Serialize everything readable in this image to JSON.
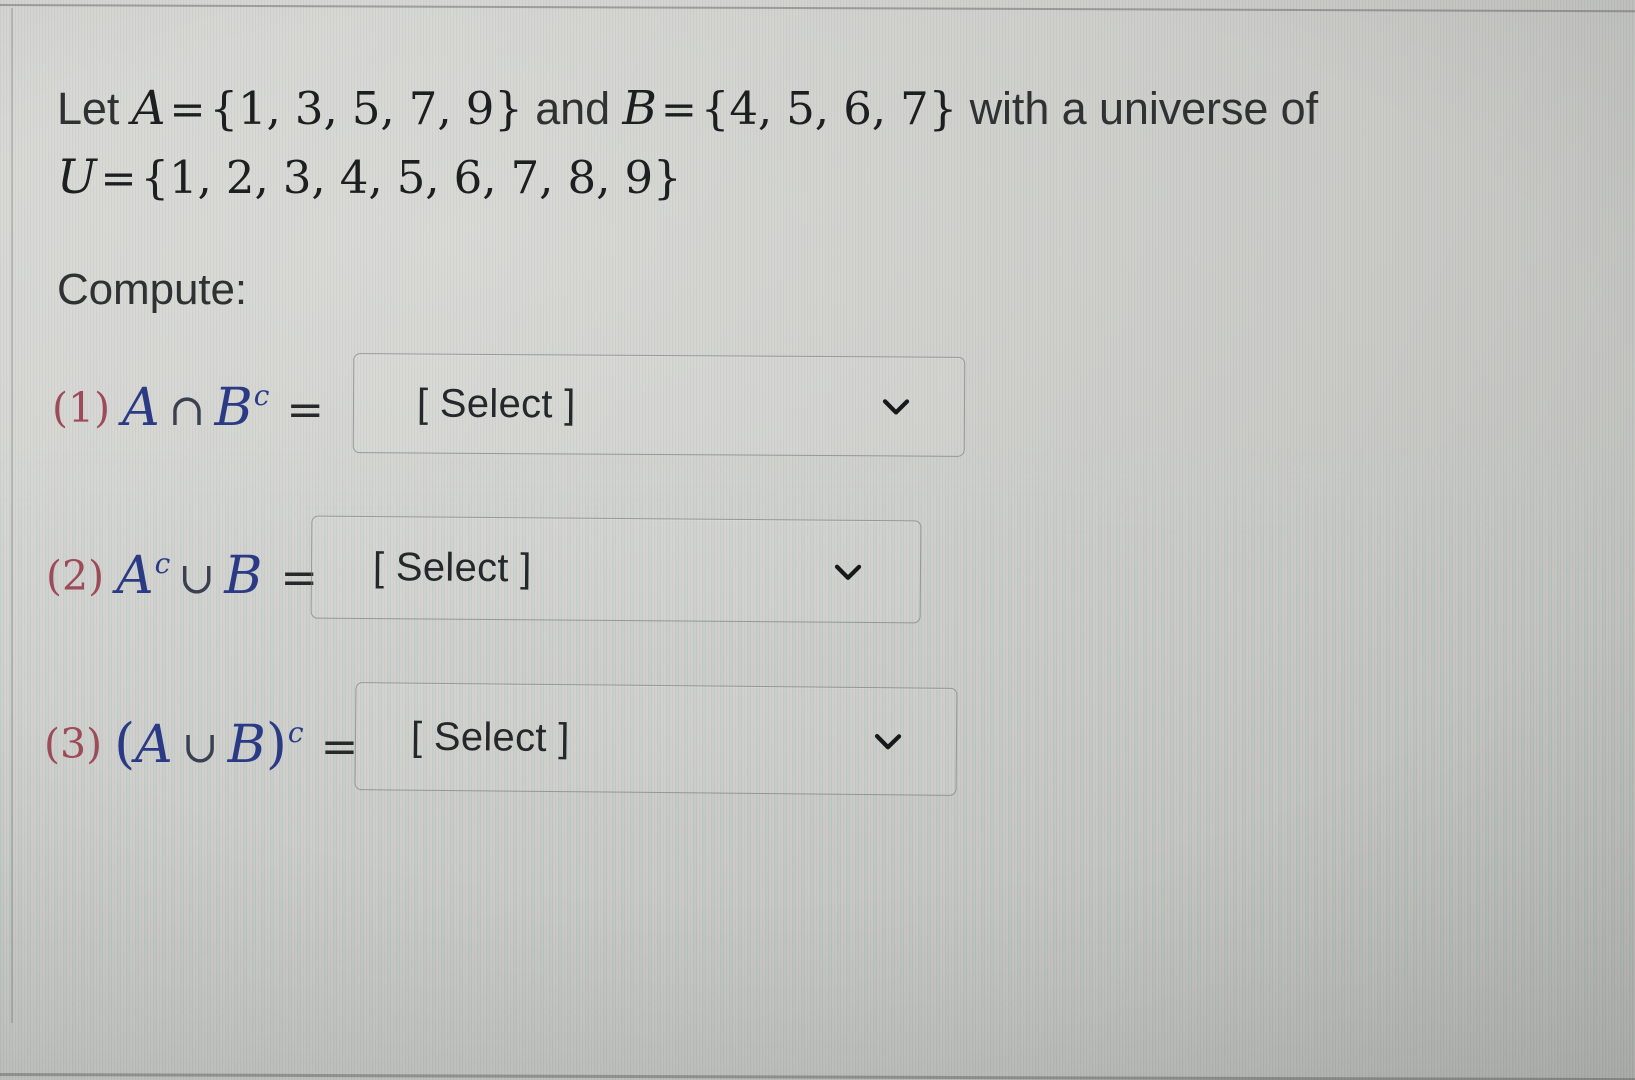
{
  "page": {
    "background_color": "#c9cbc7",
    "text_color": "#2f3133",
    "math_color": "#2b3a85",
    "number_color": "#9d4a59"
  },
  "statement": {
    "lead": "Let ",
    "set_a_name": "A",
    "eq1": "=",
    "set_a_value": "{1, 3, 5, 7, 9}",
    "conj": " and ",
    "set_b_name": "B",
    "eq2": "=",
    "set_b_value": "{4, 5, 6, 7}",
    "tail": " with a universe of",
    "universe_name": "U",
    "eq3": "=",
    "universe_value": "{1, 2, 3, 4, 5, 6, 7, 8, 9}"
  },
  "compute_label": "Compute:",
  "questions": [
    {
      "number": "(1)",
      "expression": "A ∩ B^c =",
      "parts": {
        "left_var": "A",
        "operator": "∩",
        "right_var": "B",
        "right_sup": "c",
        "equals": "="
      },
      "select": {
        "placeholder": "[ Select ]",
        "value": "",
        "icon": "chevron-down-icon"
      }
    },
    {
      "number": "(2)",
      "expression": "A^c ∪ B =",
      "parts": {
        "left_var": "A",
        "left_sup": "c",
        "operator": "∪",
        "right_var": "B",
        "equals": "="
      },
      "select": {
        "placeholder": "[ Select ]",
        "value": "",
        "icon": "chevron-down-icon"
      }
    },
    {
      "number": "(3)",
      "expression": "(A ∪ B)^c =",
      "parts": {
        "open_paren": "(",
        "left_var": "A",
        "operator": "∪",
        "right_var": "B",
        "close_paren": ")",
        "group_sup": "c",
        "equals": "="
      },
      "select": {
        "placeholder": "[ Select ]",
        "value": "",
        "icon": "chevron-down-icon"
      }
    }
  ]
}
